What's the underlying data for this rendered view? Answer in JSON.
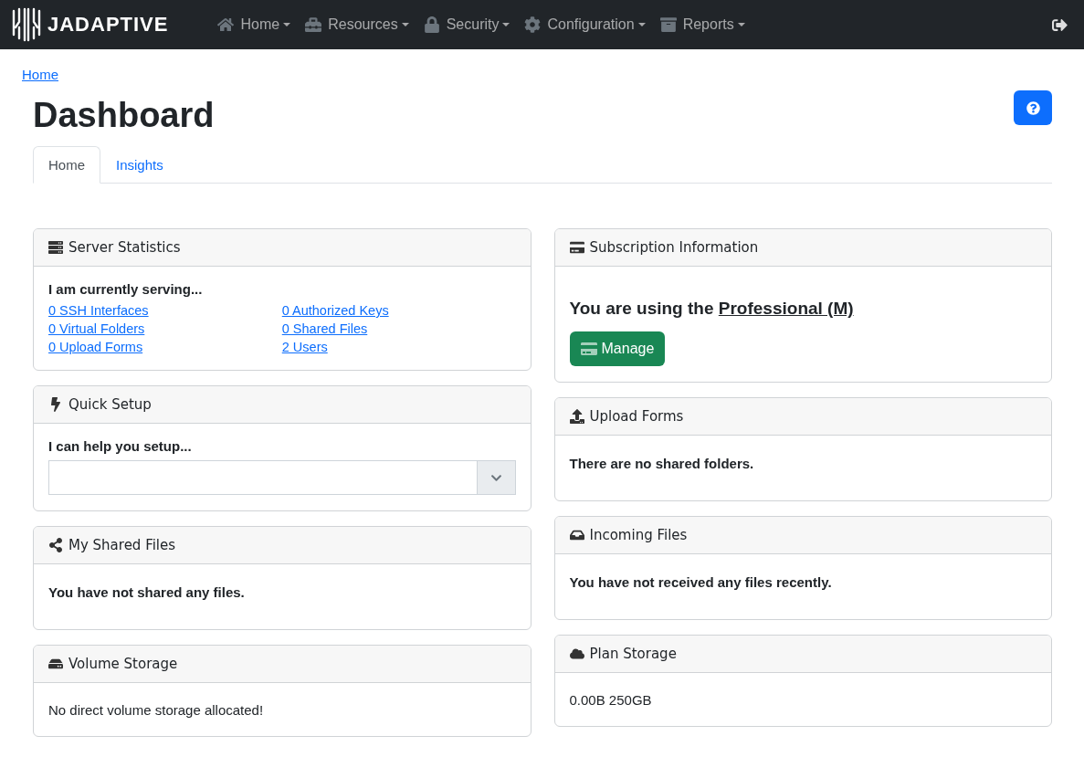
{
  "navbar": {
    "brand": "JADAPTIVE",
    "items": [
      {
        "label": "Home"
      },
      {
        "label": "Resources"
      },
      {
        "label": "Security"
      },
      {
        "label": "Configuration"
      },
      {
        "label": "Reports"
      }
    ]
  },
  "breadcrumb": "Home",
  "title": "Dashboard",
  "tabs": [
    {
      "label": "Home",
      "selected": true
    },
    {
      "label": "Insights",
      "selected": false
    }
  ],
  "columns": [
    {
      "cards": [
        {
          "kind": "links",
          "title": "Server Statistics",
          "heading": "I am currently serving...",
          "links": [
            "0 SSH Interfaces",
            "0 Authorized Keys",
            "0 Virtual Folders",
            "0 Shared Files",
            "0 Upload Forms",
            "2 Users"
          ]
        },
        {
          "kind": "select",
          "title": "Quick Setup",
          "heading": "I can help you setup..."
        },
        {
          "kind": "message",
          "title": "My Shared Files",
          "text": "You have not shared any files."
        },
        {
          "kind": "text",
          "title": "Volume Storage",
          "text": "No direct volume storage allocated!"
        }
      ]
    },
    {
      "cards": [
        {
          "kind": "plan",
          "title": "Subscription Information",
          "text": "You are using the",
          "plan": "Professional (M)",
          "button": "Manage"
        },
        {
          "kind": "message",
          "title": "Upload Forms",
          "text": "There are no shared folders."
        },
        {
          "kind": "message",
          "title": "Incoming Files",
          "text": "You have not received any files recently."
        },
        {
          "kind": "text",
          "title": "Plan Storage",
          "text": "0.00B 250GB"
        }
      ]
    }
  ]
}
